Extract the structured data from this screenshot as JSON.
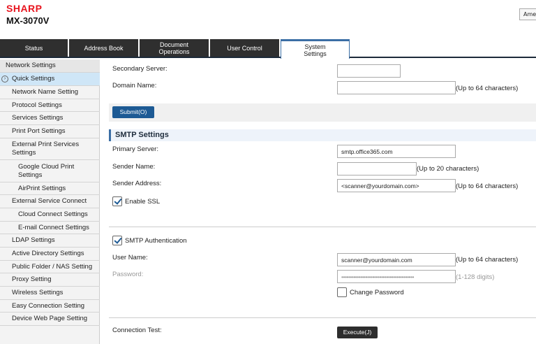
{
  "header": {
    "brand": "SHARP",
    "model": "MX-3070V",
    "language_button": "Ame"
  },
  "tabs": [
    {
      "label": "Status"
    },
    {
      "label": "Address Book"
    },
    {
      "label": "Document Operations"
    },
    {
      "label": "User Control"
    },
    {
      "label": "System Settings",
      "active": true
    }
  ],
  "sidebar": {
    "items": [
      {
        "label": "Network Settings"
      },
      {
        "label": "Quick Settings",
        "active": true
      },
      {
        "label": "Network Name Setting"
      },
      {
        "label": "Protocol Settings"
      },
      {
        "label": "Services Settings"
      },
      {
        "label": "Print Port Settings"
      },
      {
        "label": "External Print Services Settings"
      },
      {
        "label": "Google Cloud Print Settings"
      },
      {
        "label": "AirPrint Settings"
      },
      {
        "label": "External Service Connect"
      },
      {
        "label": "Cloud Connect Settings"
      },
      {
        "label": "E-mail Connect Settings"
      },
      {
        "label": "LDAP Settings"
      },
      {
        "label": "Active Directory Settings"
      },
      {
        "label": "Public Folder / NAS Setting"
      },
      {
        "label": "Proxy Setting"
      },
      {
        "label": "Wireless Settings"
      },
      {
        "label": "Easy Connection Setting"
      },
      {
        "label": "Device Web Page Setting"
      }
    ]
  },
  "dns": {
    "secondary_server_label": "Secondary Server:",
    "secondary_server_value": "",
    "domain_name_label": "Domain Name:",
    "domain_name_value": "",
    "domain_name_hint": "(Up to 64 characters)"
  },
  "submit_button": "Submit(O)",
  "smtp": {
    "section_title": "SMTP Settings",
    "primary_server_label": "Primary Server:",
    "primary_server_value": "smtp.office365.com",
    "sender_name_label": "Sender Name:",
    "sender_name_value": "",
    "sender_name_hint": "(Up to 20 characters)",
    "sender_address_label": "Sender Address:",
    "sender_address_value": "<scanner@yourdomain.com>",
    "sender_address_hint": "(Up to 64 characters)",
    "enable_ssl_label": "Enable SSL",
    "enable_ssl_checked": true,
    "smtp_auth_label": "SMTP Authentication",
    "smtp_auth_checked": true,
    "user_name_label": "User Name:",
    "user_name_value": "scanner@yourdomain.com",
    "user_name_hint": "(Up to 64 characters)",
    "password_label": "Password:",
    "password_value": "••••••••••••••••••••••••••••••••••••••••••",
    "password_hint": "(1-128 digits)",
    "change_password_label": "Change Password",
    "change_password_checked": false,
    "connection_test_label": "Connection Test:",
    "execute_button": "Execute(J)"
  },
  "colors": {
    "brand": "#e8141e",
    "accent": "#1d5a94",
    "tab_dark": "#2f2f2f",
    "sidebar_active": "#cfe6f7"
  }
}
